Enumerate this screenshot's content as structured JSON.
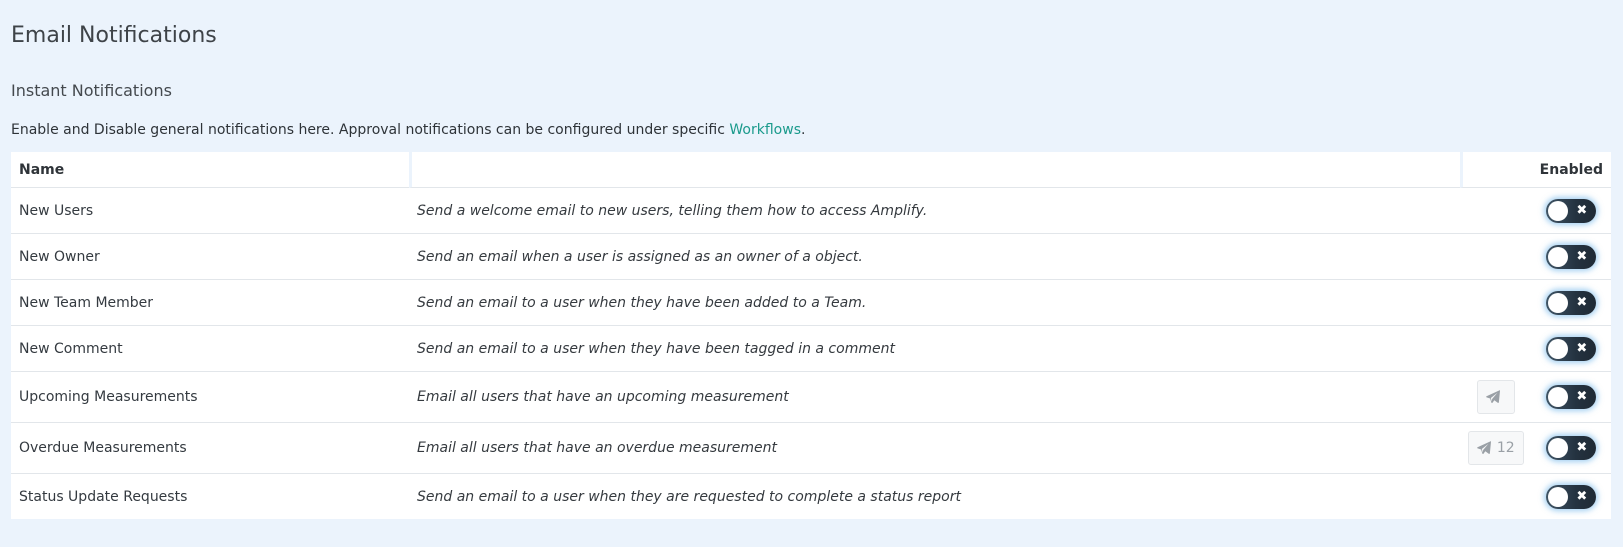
{
  "page": {
    "title": "Email Notifications",
    "section_title": "Instant Notifications",
    "intro_text": "Enable and Disable general notifications here. Approval notifications can be configured under specific ",
    "intro_link": "Workflows",
    "intro_end": "."
  },
  "table": {
    "headers": {
      "name": "Name",
      "description": "",
      "send": "",
      "enabled": "Enabled"
    },
    "rows": [
      {
        "name": "New Users",
        "description": "Send a welcome email to new users, telling them how to access Amplify.",
        "send_count": "",
        "has_send": false,
        "enabled": false
      },
      {
        "name": "New Owner",
        "description": "Send an email when a user is assigned as an owner of a object.",
        "send_count": "",
        "has_send": false,
        "enabled": false
      },
      {
        "name": "New Team Member",
        "description": "Send an email to a user when they have been added to a Team.",
        "send_count": "",
        "has_send": false,
        "enabled": false
      },
      {
        "name": "New Comment",
        "description": "Send an email to a user when they have been tagged in a comment",
        "send_count": "",
        "has_send": false,
        "enabled": false
      },
      {
        "name": "Upcoming Measurements",
        "description": "Email all users that have an upcoming measurement",
        "send_count": "",
        "has_send": true,
        "enabled": false
      },
      {
        "name": "Overdue Measurements",
        "description": "Email all users that have an overdue measurement",
        "send_count": "12",
        "has_send": true,
        "enabled": false
      },
      {
        "name": "Status Update Requests",
        "description": "Send an email to a user when they are requested to complete a status report",
        "send_count": "",
        "has_send": false,
        "enabled": false
      }
    ]
  },
  "icons": {
    "send": "paper-plane-icon",
    "toggle_off": "x-icon"
  },
  "colors": {
    "background": "#ebf3fc",
    "link": "#1a9a8c",
    "toggle_track": "#243240",
    "toggle_glow": "#5aaae6"
  }
}
